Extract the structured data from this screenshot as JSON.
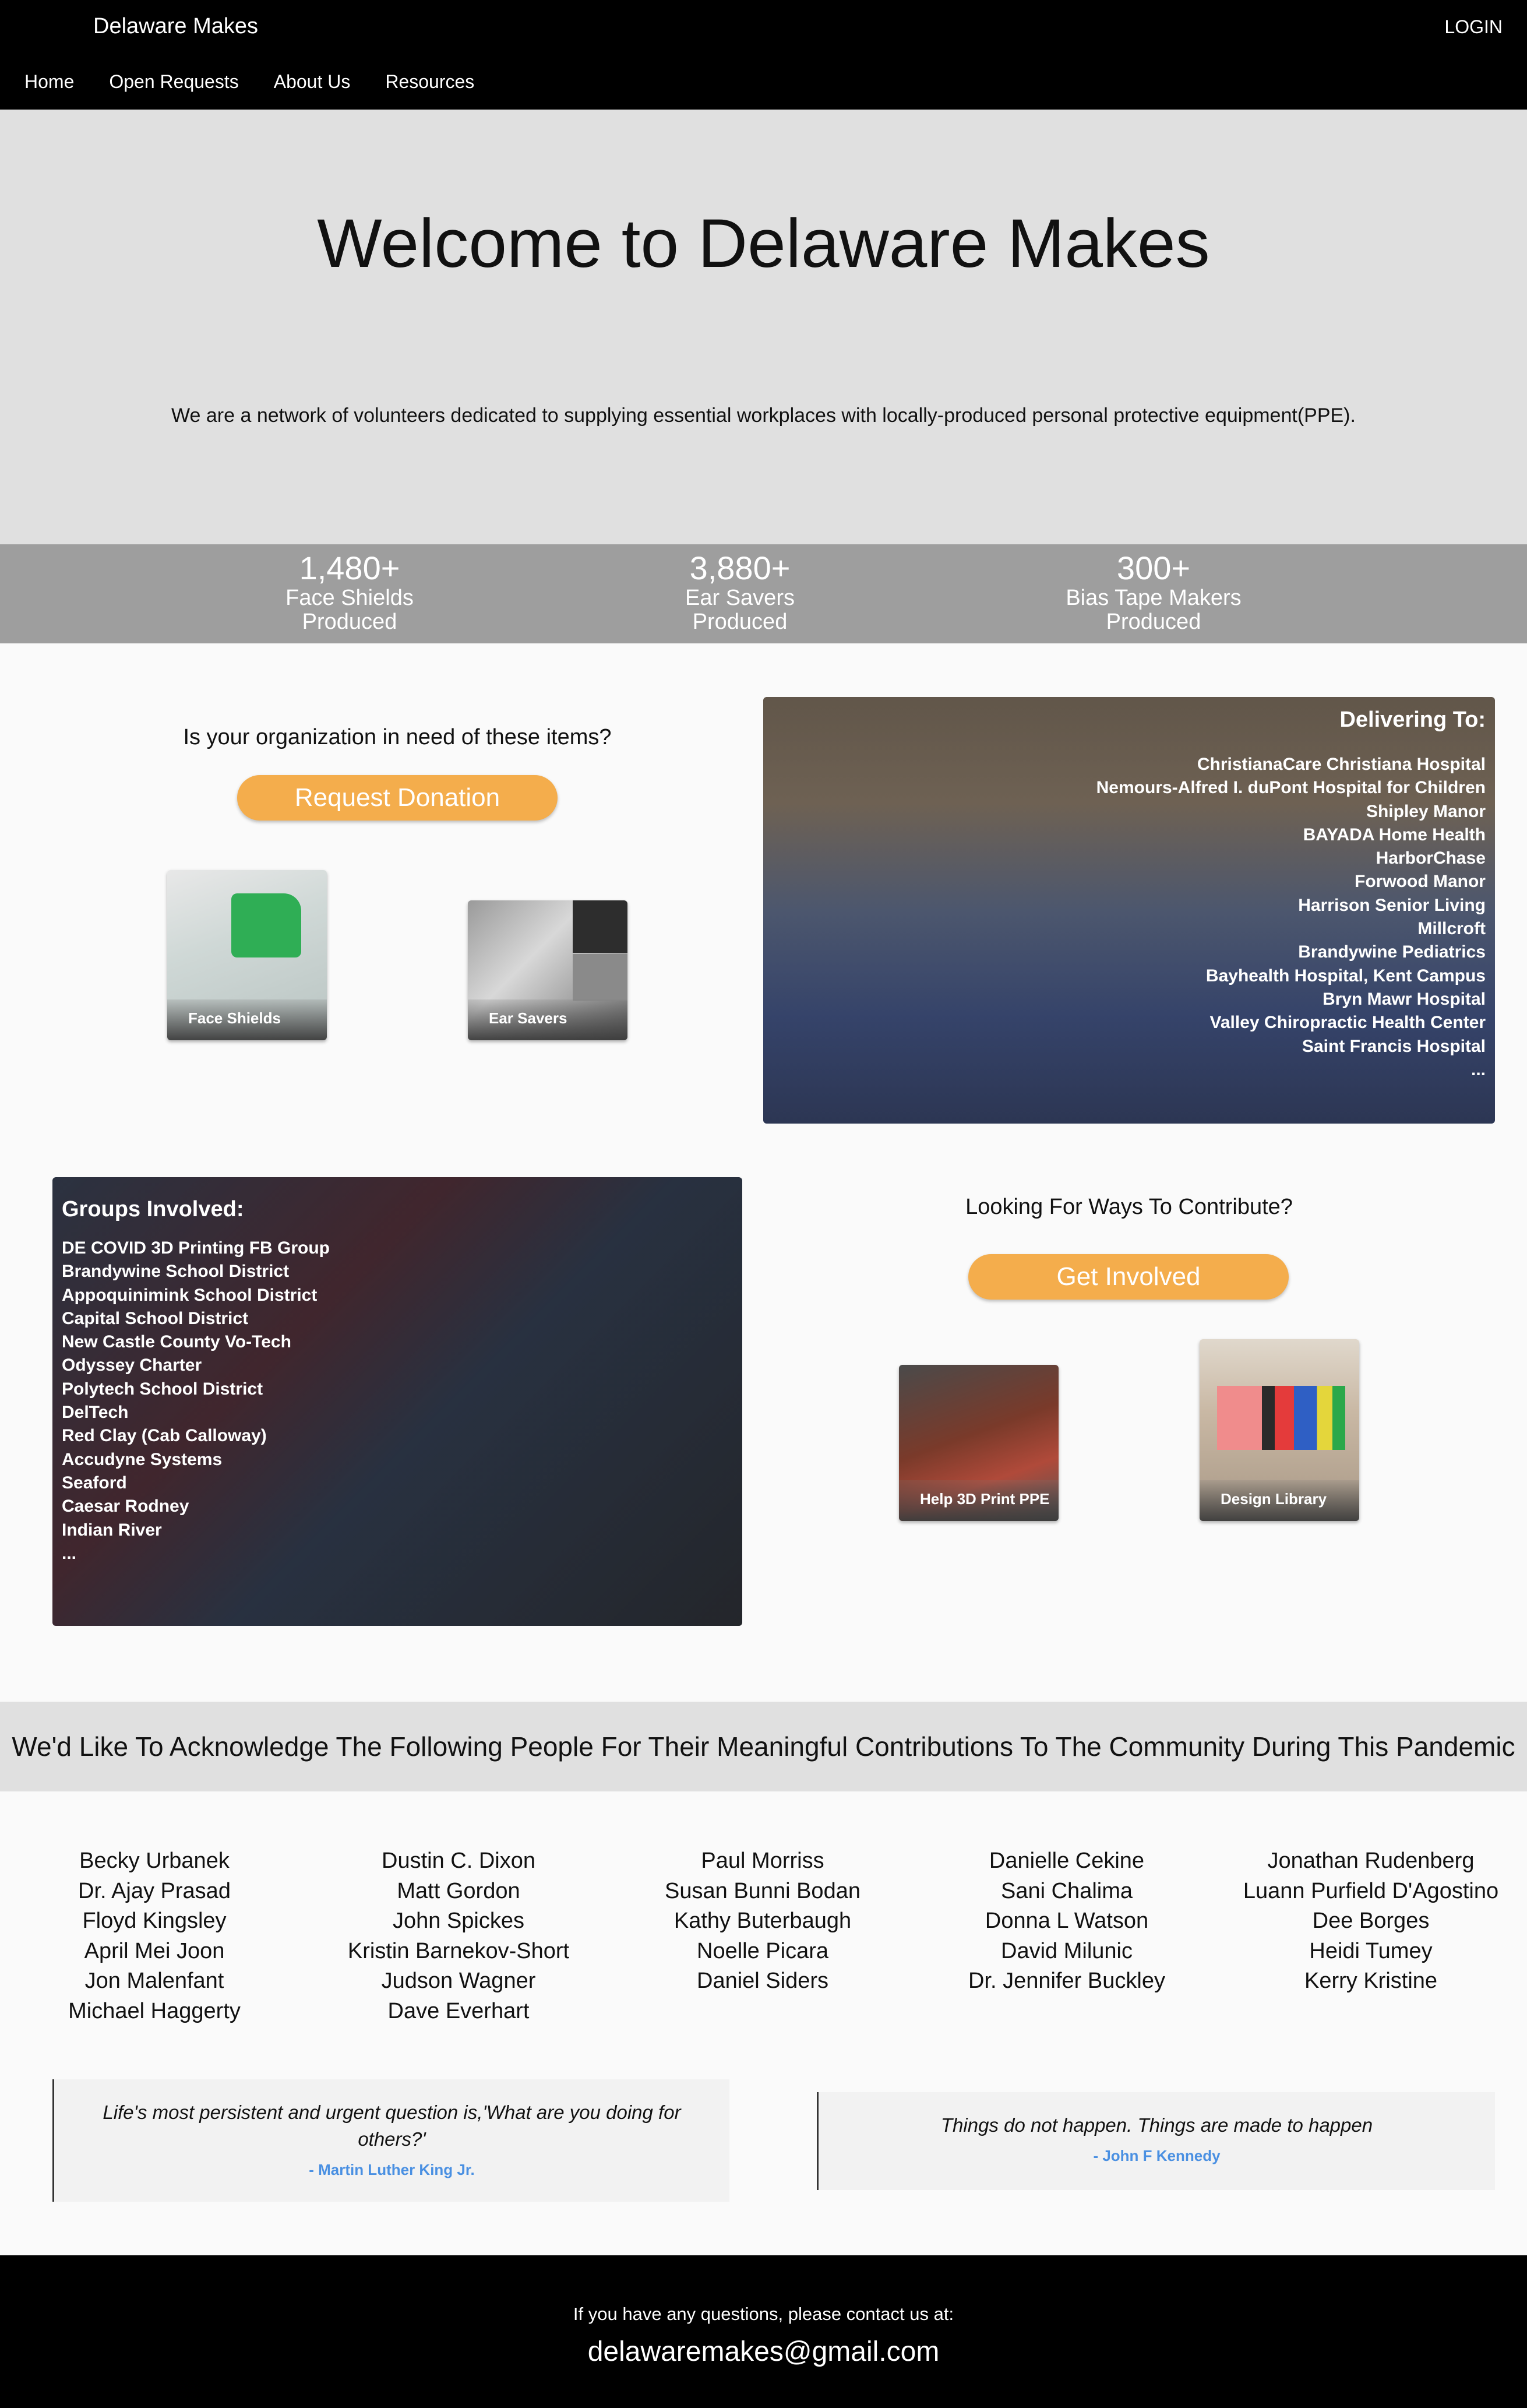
{
  "header": {
    "brand": "Delaware Makes",
    "login": "LOGIN",
    "nav": [
      "Home",
      "Open Requests",
      "About Us",
      "Resources"
    ]
  },
  "hero": {
    "title": "Welcome to Delaware Makes",
    "subtitle": "We are a network of volunteers dedicated to supplying essential workplaces with locally-produced personal protective equipment(PPE)."
  },
  "stats": [
    {
      "value": "1,480+",
      "label1": "Face Shields",
      "label2": "Produced"
    },
    {
      "value": "3,880+",
      "label1": "Ear Savers",
      "label2": "Produced"
    },
    {
      "value": "300+",
      "label1": "Bias Tape Makers",
      "label2": "Produced"
    }
  ],
  "request": {
    "question": "Is your organization in need of these items?",
    "button": "Request Donation",
    "cards": [
      "Face Shields",
      "Ear Savers"
    ]
  },
  "delivering": {
    "title": "Delivering To:",
    "items": [
      "ChristianaCare Christiana Hospital",
      "Nemours-Alfred I. duPont Hospital for Children",
      "Shipley Manor",
      "BAYADA Home Health",
      "HarborChase",
      "Forwood Manor",
      "Harrison Senior Living",
      "Millcroft",
      "Brandywine Pediatrics",
      "Bayhealth Hospital, Kent Campus",
      "Bryn Mawr Hospital",
      "Valley Chiropractic Health Center",
      "Saint Francis Hospital",
      "..."
    ]
  },
  "groups": {
    "title": "Groups Involved:",
    "items": [
      "DE COVID 3D Printing FB Group",
      "Brandywine School District",
      "Appoquinimink School District",
      "Capital School District",
      "New Castle County Vo-Tech",
      "Odyssey Charter",
      "Polytech School District",
      "DelTech",
      "Red Clay (Cab Calloway)",
      "Accudyne Systems",
      "Seaford",
      "Caesar Rodney",
      "Indian River",
      "..."
    ]
  },
  "contribute": {
    "question": "Looking For Ways To Contribute?",
    "button": "Get Involved",
    "cards": [
      "Help 3D Print PPE",
      "Design Library"
    ]
  },
  "acknowledgements": {
    "title": "We'd Like To Acknowledge The Following People For Their Meaningful Contributions To The Community During This Pandemic",
    "columns": [
      [
        "Becky Urbanek",
        "Dr. Ajay Prasad",
        "Floyd Kingsley",
        "April Mei Joon",
        "Jon Malenfant",
        "Michael Haggerty"
      ],
      [
        "Dustin C. Dixon",
        "Matt Gordon",
        "John Spickes",
        "Kristin Barnekov-Short",
        "Judson Wagner",
        "Dave Everhart"
      ],
      [
        "Paul Morriss",
        "Susan Bunni Bodan",
        "Kathy Buterbaugh",
        "Noelle Picara",
        "Daniel Siders"
      ],
      [
        "Danielle Cekine",
        "Sani Chalima",
        "Donna L Watson",
        "David Milunic",
        "Dr. Jennifer Buckley"
      ],
      [
        "Jonathan Rudenberg",
        "Luann Purfield D'Agostino",
        "Dee Borges",
        "Heidi Tumey",
        "Kerry Kristine"
      ]
    ]
  },
  "quotes": [
    {
      "text": "Life's most persistent and urgent question is,'What are you doing for others?'",
      "author": "- Martin Luther King Jr."
    },
    {
      "text": "Things do not happen. Things are made to happen",
      "author": "- John F Kennedy"
    }
  ],
  "footer": {
    "question": "If you have any questions, please contact us at:",
    "email": "delawaremakes@gmail.com"
  },
  "colors": {
    "accent": "#f4ad4c",
    "link": "#4a90e2",
    "header": "#000000",
    "stats_band": "#9e9e9e"
  }
}
